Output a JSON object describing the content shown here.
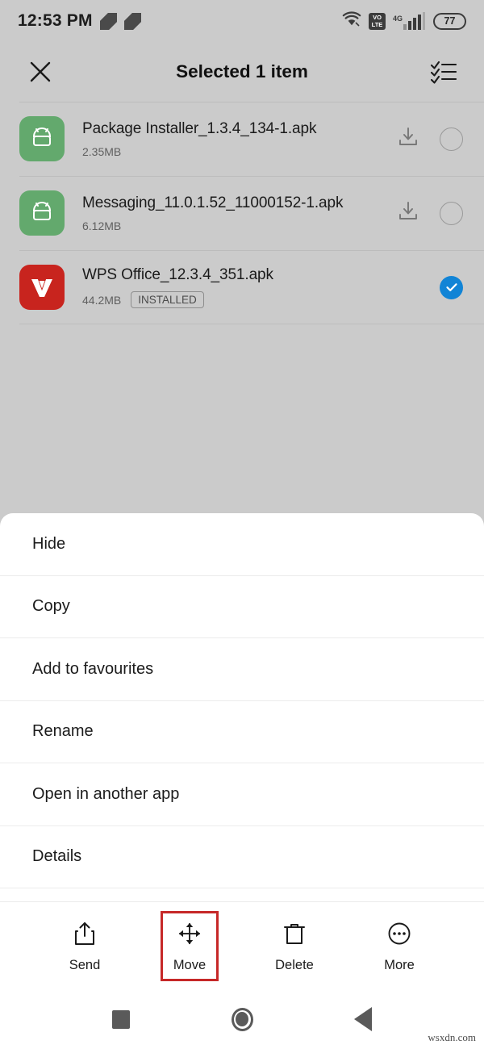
{
  "status_bar": {
    "time": "12:53 PM",
    "left_icons": [
      "app-glyph-icon",
      "app-glyph-icon"
    ],
    "wifi_icon": "wifi-icon",
    "volte_top": "VO",
    "volte_bottom": "LTE",
    "network_label": "4G",
    "signal_icon": "signal-bars-icon",
    "battery_level": "77"
  },
  "app_bar": {
    "close_icon": "close-icon",
    "title": "Selected 1 item",
    "select_all_icon": "select-all-checklist-icon"
  },
  "files": [
    {
      "name": "Package Installer_1.3.4_134-1.apk",
      "size": "2.35MB",
      "badge": "",
      "icon": "android-apk-icon",
      "icon_color": "#63a96d",
      "download_icon": "download-install-icon",
      "selected": false
    },
    {
      "name": "Messaging_11.0.1.52_11000152-1.apk",
      "size": "6.12MB",
      "badge": "",
      "icon": "android-apk-icon",
      "icon_color": "#63a96d",
      "download_icon": "download-install-icon",
      "selected": false
    },
    {
      "name": "WPS Office_12.3.4_351.apk",
      "size": "44.2MB",
      "badge": "INSTALLED",
      "icon": "wps-office-icon",
      "icon_color": "#c8241e",
      "download_icon": "",
      "selected": true
    }
  ],
  "sheet": {
    "items": [
      {
        "label": "Hide"
      },
      {
        "label": "Copy"
      },
      {
        "label": "Add to favourites"
      },
      {
        "label": "Rename"
      },
      {
        "label": "Open in another app"
      },
      {
        "label": "Details"
      }
    ]
  },
  "toolbar": {
    "items": [
      {
        "label": "Send",
        "icon": "share-upload-icon",
        "highlighted": false
      },
      {
        "label": "Move",
        "icon": "move-arrows-icon",
        "highlighted": true
      },
      {
        "label": "Delete",
        "icon": "trash-icon",
        "highlighted": false
      },
      {
        "label": "More",
        "icon": "more-dots-icon",
        "highlighted": false
      }
    ],
    "highlight_color": "#c62828"
  },
  "nav_bar": {
    "recents_icon": "recents-square-icon",
    "home_icon": "home-circle-icon",
    "back_icon": "back-triangle-icon"
  },
  "watermark": "wsxdn.com",
  "colors": {
    "background": "#cbcbcb",
    "sheet": "#ffffff",
    "accent_selected": "#1184d6",
    "apk_green": "#63a96d",
    "wps_red": "#c8241e",
    "highlight_red": "#c62828"
  }
}
